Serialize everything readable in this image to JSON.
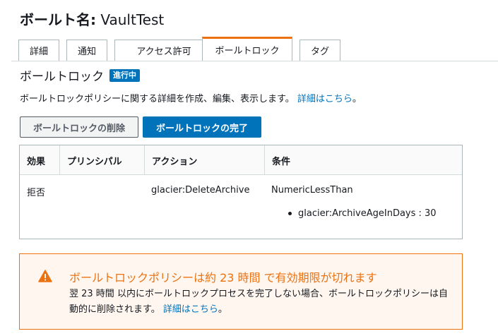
{
  "header": {
    "title_prefix": "ボールト名:",
    "vault_name": "VaultTest"
  },
  "tabs": [
    {
      "label": "詳細"
    },
    {
      "label": "通知"
    },
    {
      "label": "アクセス許可"
    },
    {
      "label": "ボールトロック",
      "active": true
    },
    {
      "label": "タグ"
    }
  ],
  "section": {
    "title": "ボールトロック",
    "status_badge": "進行中",
    "description": "ボールトロックポリシーに関する詳細を作成、編集、表示します。",
    "learn_more": "詳細はこちら",
    "period": "。"
  },
  "buttons": {
    "delete": "ボールトロックの削除",
    "complete": "ボールトロックの完了"
  },
  "table": {
    "headers": [
      "効果",
      "プリンシパル",
      "アクション",
      "条件"
    ],
    "rows": [
      {
        "effect": "拒否",
        "principal": "",
        "action": "glacier:DeleteArchive",
        "condition": "NumericLessThan",
        "condition_items": [
          "glacier:ArchiveAgeInDays : 30"
        ]
      }
    ]
  },
  "alert": {
    "icon": "warning-icon",
    "title": "ボールトロックポリシーは約 23 時間 で有効期限が切れます",
    "body": "翌 23 時間 以内にボールトロックプロセスを完了しない場合、ボールトロックポリシーは自動的に削除されます。",
    "learn_more": "詳細はこちら",
    "period": "。"
  },
  "colors": {
    "accent": "#ec7211",
    "primary": "#0073bb",
    "warning_bg": "#fef6ef"
  }
}
